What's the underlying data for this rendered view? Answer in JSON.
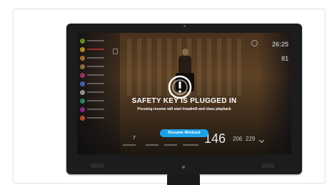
{
  "screen": {
    "headline": "SAFETY KEY IS PLUGGED IN",
    "subline": "Pressing resume will start treadmill and class playback",
    "resume_label": "Resume Workout",
    "alert_icon": "exclamation-in-circle-icon"
  },
  "stats_top": {
    "elapsed": "26:25",
    "value": "81"
  },
  "metrics": {
    "first": "7",
    "main": "146",
    "second": "206",
    "third": "229"
  },
  "colors": {
    "accent": "#1da1e6",
    "active_row": "#e04646"
  }
}
